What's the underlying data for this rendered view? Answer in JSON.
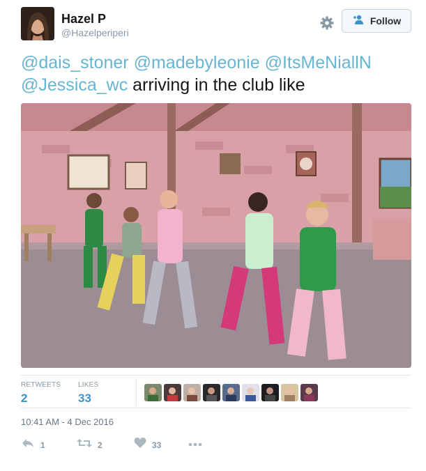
{
  "user": {
    "display_name": "Hazel P",
    "handle": "@Hazelperiperi"
  },
  "follow_button": {
    "label": "Follow"
  },
  "tweet": {
    "mentions": [
      "@dais_stoner",
      "@madebyleonie",
      "@ItsMeNiallN",
      "@Jessica_wc"
    ],
    "text": "arriving in the club like"
  },
  "media": {
    "description_icon": "video-thumbnail"
  },
  "stats": {
    "retweets_label": "RETWEETS",
    "retweets_value": "2",
    "likes_label": "LIKES",
    "likes_value": "33"
  },
  "timestamp": "10:41 AM - 4 Dec 2016",
  "actions": {
    "reply_count": "1",
    "retweet_count": "2",
    "like_count": "33"
  },
  "colors": {
    "link": "#66b5d2",
    "stat_value": "#3a94c7",
    "muted": "#8899a6"
  }
}
